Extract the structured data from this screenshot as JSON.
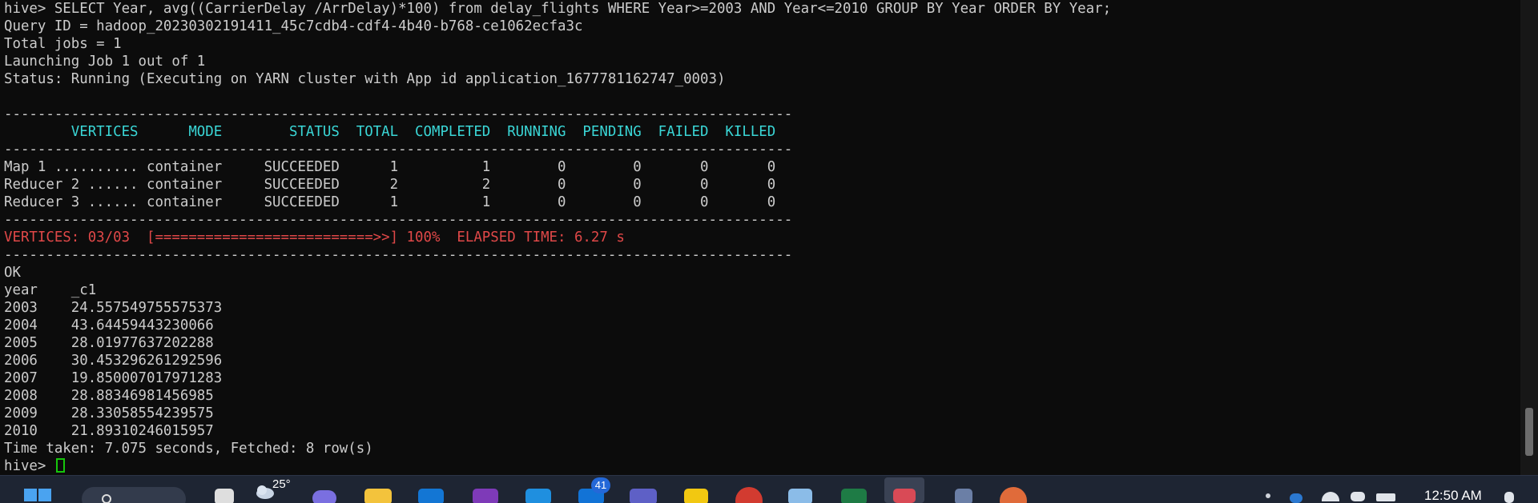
{
  "terminal": {
    "lines": [
      {
        "text": "hive> SELECT Year, avg((CarrierDelay /ArrDelay)*100) from delay_flights WHERE Year>=2003 AND Year<=2010 GROUP BY Year ORDER BY Year;",
        "style": "normal"
      },
      {
        "text": "Query ID = hadoop_20230302191411_45c7cdb4-cdf4-4b40-b768-ce1062ecfa3c",
        "style": "normal"
      },
      {
        "text": "Total jobs = 1",
        "style": "normal"
      },
      {
        "text": "Launching Job 1 out of 1",
        "style": "normal"
      },
      {
        "text": "Status: Running (Executing on YARN cluster with App id application_1677781162747_0003)",
        "style": "normal"
      },
      {
        "text": "",
        "style": "normal"
      },
      {
        "text": "----------------------------------------------------------------------------------------------",
        "style": "normal"
      },
      {
        "text": "        VERTICES      MODE        STATUS  TOTAL  COMPLETED  RUNNING  PENDING  FAILED  KILLED",
        "style": "cyan"
      },
      {
        "text": "----------------------------------------------------------------------------------------------",
        "style": "normal"
      },
      {
        "text": "Map 1 .......... container     SUCCEEDED      1          1        0        0       0       0",
        "style": "normal"
      },
      {
        "text": "Reducer 2 ...... container     SUCCEEDED      2          2        0        0       0       0",
        "style": "normal"
      },
      {
        "text": "Reducer 3 ...... container     SUCCEEDED      1          1        0        0       0       0",
        "style": "normal"
      },
      {
        "text": "----------------------------------------------------------------------------------------------",
        "style": "normal"
      },
      {
        "text": "VERTICES: 03/03  [==========================>>] 100%  ELAPSED TIME: 6.27 s",
        "style": "red"
      },
      {
        "text": "----------------------------------------------------------------------------------------------",
        "style": "normal"
      },
      {
        "text": "OK",
        "style": "normal"
      },
      {
        "text": "year    _c1",
        "style": "normal"
      },
      {
        "text": "2003    24.557549755575373",
        "style": "normal"
      },
      {
        "text": "2004    43.64459443230066",
        "style": "normal"
      },
      {
        "text": "2005    28.01977637202288",
        "style": "normal"
      },
      {
        "text": "2006    30.453296261292596",
        "style": "normal"
      },
      {
        "text": "2007    19.850007017971283",
        "style": "normal"
      },
      {
        "text": "2008    28.88346981456985",
        "style": "normal"
      },
      {
        "text": "2009    28.33058554239575",
        "style": "normal"
      },
      {
        "text": "2010    21.89310246015957",
        "style": "normal"
      },
      {
        "text": "Time taken: 7.075 seconds, Fetched: 8 row(s)",
        "style": "normal"
      }
    ],
    "prompt": "hive> "
  },
  "taskbar": {
    "weather_temp": "25°",
    "badge_count": "41",
    "clock_time": "12:50 AM"
  }
}
